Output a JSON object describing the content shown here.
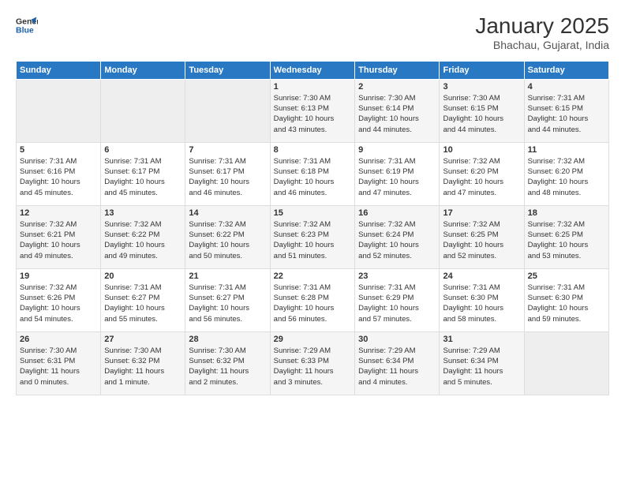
{
  "header": {
    "logo_line1": "General",
    "logo_line2": "Blue",
    "title": "January 2025",
    "subtitle": "Bhachau, Gujarat, India"
  },
  "days_of_week": [
    "Sunday",
    "Monday",
    "Tuesday",
    "Wednesday",
    "Thursday",
    "Friday",
    "Saturday"
  ],
  "weeks": [
    [
      {
        "day": "",
        "info": ""
      },
      {
        "day": "",
        "info": ""
      },
      {
        "day": "",
        "info": ""
      },
      {
        "day": "1",
        "info": "Sunrise: 7:30 AM\nSunset: 6:13 PM\nDaylight: 10 hours\nand 43 minutes."
      },
      {
        "day": "2",
        "info": "Sunrise: 7:30 AM\nSunset: 6:14 PM\nDaylight: 10 hours\nand 44 minutes."
      },
      {
        "day": "3",
        "info": "Sunrise: 7:30 AM\nSunset: 6:15 PM\nDaylight: 10 hours\nand 44 minutes."
      },
      {
        "day": "4",
        "info": "Sunrise: 7:31 AM\nSunset: 6:15 PM\nDaylight: 10 hours\nand 44 minutes."
      }
    ],
    [
      {
        "day": "5",
        "info": "Sunrise: 7:31 AM\nSunset: 6:16 PM\nDaylight: 10 hours\nand 45 minutes."
      },
      {
        "day": "6",
        "info": "Sunrise: 7:31 AM\nSunset: 6:17 PM\nDaylight: 10 hours\nand 45 minutes."
      },
      {
        "day": "7",
        "info": "Sunrise: 7:31 AM\nSunset: 6:17 PM\nDaylight: 10 hours\nand 46 minutes."
      },
      {
        "day": "8",
        "info": "Sunrise: 7:31 AM\nSunset: 6:18 PM\nDaylight: 10 hours\nand 46 minutes."
      },
      {
        "day": "9",
        "info": "Sunrise: 7:31 AM\nSunset: 6:19 PM\nDaylight: 10 hours\nand 47 minutes."
      },
      {
        "day": "10",
        "info": "Sunrise: 7:32 AM\nSunset: 6:20 PM\nDaylight: 10 hours\nand 47 minutes."
      },
      {
        "day": "11",
        "info": "Sunrise: 7:32 AM\nSunset: 6:20 PM\nDaylight: 10 hours\nand 48 minutes."
      }
    ],
    [
      {
        "day": "12",
        "info": "Sunrise: 7:32 AM\nSunset: 6:21 PM\nDaylight: 10 hours\nand 49 minutes."
      },
      {
        "day": "13",
        "info": "Sunrise: 7:32 AM\nSunset: 6:22 PM\nDaylight: 10 hours\nand 49 minutes."
      },
      {
        "day": "14",
        "info": "Sunrise: 7:32 AM\nSunset: 6:22 PM\nDaylight: 10 hours\nand 50 minutes."
      },
      {
        "day": "15",
        "info": "Sunrise: 7:32 AM\nSunset: 6:23 PM\nDaylight: 10 hours\nand 51 minutes."
      },
      {
        "day": "16",
        "info": "Sunrise: 7:32 AM\nSunset: 6:24 PM\nDaylight: 10 hours\nand 52 minutes."
      },
      {
        "day": "17",
        "info": "Sunrise: 7:32 AM\nSunset: 6:25 PM\nDaylight: 10 hours\nand 52 minutes."
      },
      {
        "day": "18",
        "info": "Sunrise: 7:32 AM\nSunset: 6:25 PM\nDaylight: 10 hours\nand 53 minutes."
      }
    ],
    [
      {
        "day": "19",
        "info": "Sunrise: 7:32 AM\nSunset: 6:26 PM\nDaylight: 10 hours\nand 54 minutes."
      },
      {
        "day": "20",
        "info": "Sunrise: 7:31 AM\nSunset: 6:27 PM\nDaylight: 10 hours\nand 55 minutes."
      },
      {
        "day": "21",
        "info": "Sunrise: 7:31 AM\nSunset: 6:27 PM\nDaylight: 10 hours\nand 56 minutes."
      },
      {
        "day": "22",
        "info": "Sunrise: 7:31 AM\nSunset: 6:28 PM\nDaylight: 10 hours\nand 56 minutes."
      },
      {
        "day": "23",
        "info": "Sunrise: 7:31 AM\nSunset: 6:29 PM\nDaylight: 10 hours\nand 57 minutes."
      },
      {
        "day": "24",
        "info": "Sunrise: 7:31 AM\nSunset: 6:30 PM\nDaylight: 10 hours\nand 58 minutes."
      },
      {
        "day": "25",
        "info": "Sunrise: 7:31 AM\nSunset: 6:30 PM\nDaylight: 10 hours\nand 59 minutes."
      }
    ],
    [
      {
        "day": "26",
        "info": "Sunrise: 7:30 AM\nSunset: 6:31 PM\nDaylight: 11 hours\nand 0 minutes."
      },
      {
        "day": "27",
        "info": "Sunrise: 7:30 AM\nSunset: 6:32 PM\nDaylight: 11 hours\nand 1 minute."
      },
      {
        "day": "28",
        "info": "Sunrise: 7:30 AM\nSunset: 6:32 PM\nDaylight: 11 hours\nand 2 minutes."
      },
      {
        "day": "29",
        "info": "Sunrise: 7:29 AM\nSunset: 6:33 PM\nDaylight: 11 hours\nand 3 minutes."
      },
      {
        "day": "30",
        "info": "Sunrise: 7:29 AM\nSunset: 6:34 PM\nDaylight: 11 hours\nand 4 minutes."
      },
      {
        "day": "31",
        "info": "Sunrise: 7:29 AM\nSunset: 6:34 PM\nDaylight: 11 hours\nand 5 minutes."
      },
      {
        "day": "",
        "info": ""
      }
    ]
  ]
}
